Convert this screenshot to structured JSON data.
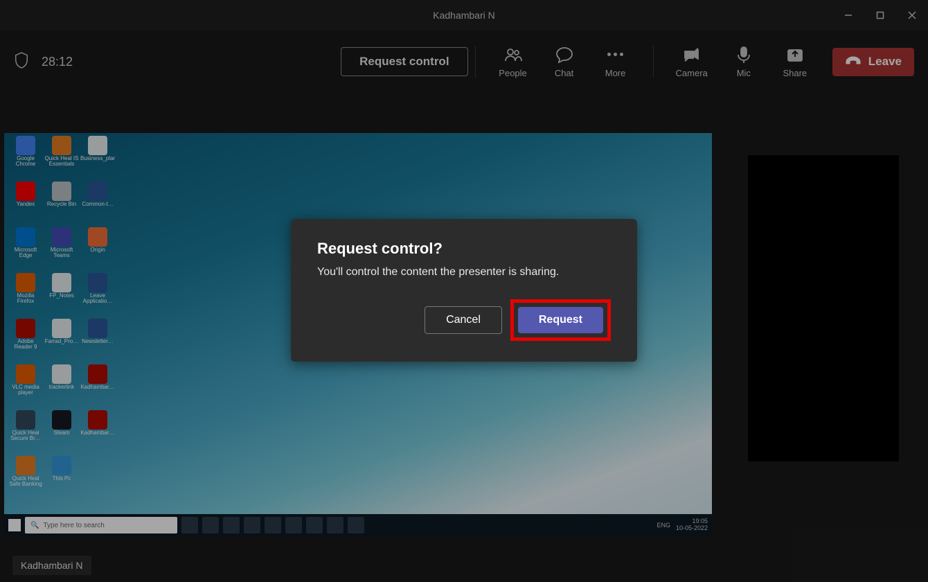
{
  "titlebar": {
    "title": "Kadhambari N"
  },
  "toolbar": {
    "timer": "28:12",
    "request_control_label": "Request control",
    "people_label": "People",
    "chat_label": "Chat",
    "more_label": "More",
    "camera_label": "Camera",
    "mic_label": "Mic",
    "share_label": "Share",
    "leave_label": "Leave"
  },
  "modal": {
    "title": "Request control?",
    "body": "You'll control the content the presenter is sharing.",
    "cancel_label": "Cancel",
    "request_label": "Request"
  },
  "presenter": {
    "name_label": "Kadhambari N"
  },
  "shared_desktop": {
    "search_placeholder": "Type here to search",
    "tray_lang": "ENG",
    "tray_time": "19:05",
    "tray_date": "10-05-2022",
    "icons": [
      {
        "label": "Google Chrome",
        "color": "#4285f4"
      },
      {
        "label": "Quick Heal IS Essentials",
        "color": "#e67e22"
      },
      {
        "label": "Business_plan",
        "color": "#ecf0f1"
      },
      {
        "label": "Yandex",
        "color": "#ff0000"
      },
      {
        "label": "Recycle Bin",
        "color": "#bdc3c7"
      },
      {
        "label": "Common-t…",
        "color": "#2b579a"
      },
      {
        "label": "Microsoft Edge",
        "color": "#0078d7"
      },
      {
        "label": "Microsoft Teams",
        "color": "#464eb8"
      },
      {
        "label": "Origin",
        "color": "#f56f36"
      },
      {
        "label": "Mozilla Firefox",
        "color": "#e66000"
      },
      {
        "label": "FP_Notes",
        "color": "#ecf0f1"
      },
      {
        "label": "Leave Applicatio…",
        "color": "#2b579a"
      },
      {
        "label": "Adobe Reader 9",
        "color": "#b30b00"
      },
      {
        "label": "Farrad_Pro…",
        "color": "#ecf0f1"
      },
      {
        "label": "Newsletter…",
        "color": "#2b579a"
      },
      {
        "label": "VLC media player",
        "color": "#e85e00"
      },
      {
        "label": "trackerlink",
        "color": "#ecf0f1"
      },
      {
        "label": "Kadhambar…",
        "color": "#b30b00"
      },
      {
        "label": "Quick Heal Secure Br…",
        "color": "#34495e"
      },
      {
        "label": "Steam",
        "color": "#171a21"
      },
      {
        "label": "Kadhambar…",
        "color": "#b30b00"
      },
      {
        "label": "Quick Heal Safe Banking",
        "color": "#e67e22"
      },
      {
        "label": "This Pc",
        "color": "#3498db"
      }
    ]
  }
}
